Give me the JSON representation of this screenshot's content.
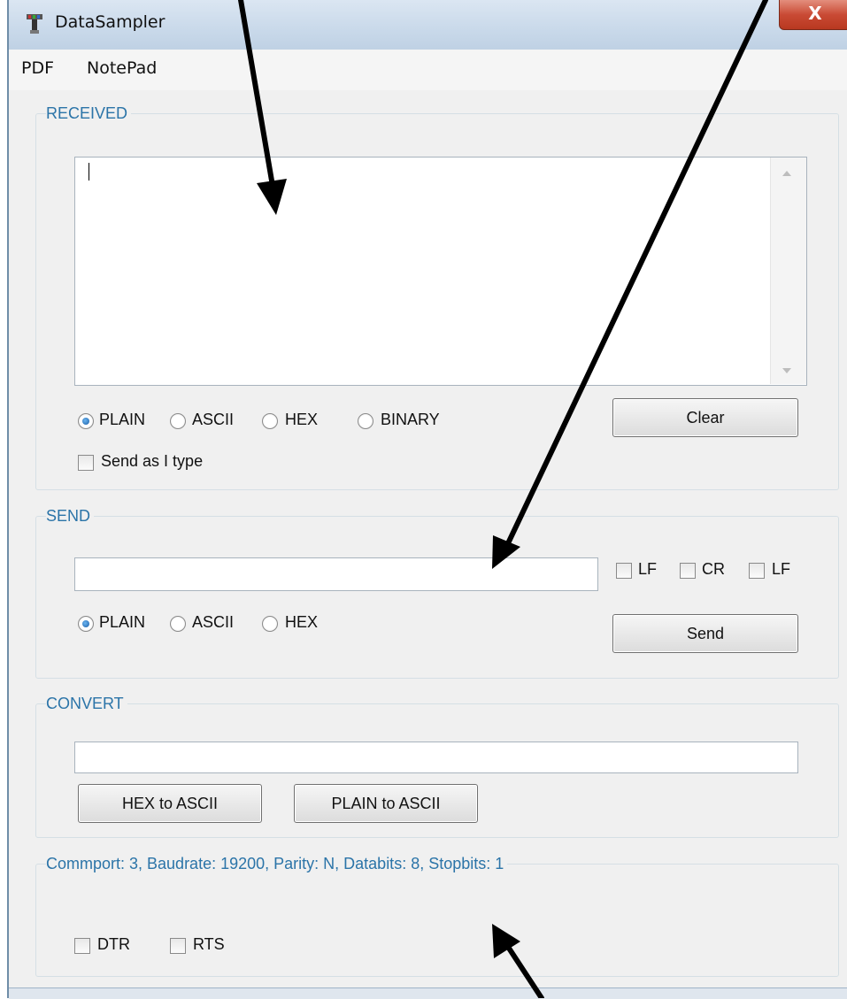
{
  "window": {
    "title": "DataSampler",
    "close_glyph": "X",
    "icon": "datasampler-app-icon"
  },
  "menu": {
    "items": [
      "PDF",
      "NotePad"
    ]
  },
  "received": {
    "legend": "RECEIVED",
    "text": "",
    "modes": [
      {
        "label": "PLAIN",
        "selected": true
      },
      {
        "label": "ASCII",
        "selected": false
      },
      {
        "label": "HEX",
        "selected": false
      },
      {
        "label": "BINARY",
        "selected": false
      }
    ],
    "send_as_i_type_label": "Send as I type",
    "send_as_i_type_checked": false,
    "clear_label": "Clear"
  },
  "send": {
    "legend": "SEND",
    "value": "",
    "line_endings": [
      {
        "label": "LF",
        "checked": false
      },
      {
        "label": "CR",
        "checked": false
      },
      {
        "label": "LF",
        "checked": false
      }
    ],
    "modes": [
      {
        "label": "PLAIN",
        "selected": true
      },
      {
        "label": "ASCII",
        "selected": false
      },
      {
        "label": "HEX",
        "selected": false
      }
    ],
    "send_label": "Send"
  },
  "convert": {
    "legend": "CONVERT",
    "value": "",
    "hex_to_ascii_label": "HEX to ASCII",
    "plain_to_ascii_label": "PLAIN to ASCII"
  },
  "port": {
    "legend": "Commport:  3, Baudrate: 19200, Parity: N, Databits: 8, Stopbits: 1",
    "dtr_label": "DTR",
    "dtr_checked": false,
    "rts_label": "RTS",
    "rts_checked": false
  },
  "colors": {
    "legend_text": "#2b74a8",
    "window_bg": "#f0f0f0",
    "close_button": "#c94a34",
    "radio_selected": "#1b5fa8",
    "annotation_arrow": "#000000"
  }
}
